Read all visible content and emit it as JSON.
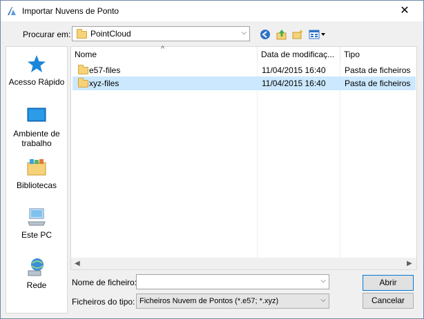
{
  "window": {
    "title": "Importar Nuvens de Ponto",
    "close_glyph": "✕"
  },
  "lookin": {
    "label": "Procurar em:",
    "value": "PointCloud"
  },
  "toolbar": {
    "icons": [
      "back-icon",
      "up-folder-icon",
      "new-folder-icon",
      "view-menu-icon"
    ]
  },
  "places": [
    {
      "label": "Acesso Rápido",
      "icon": "star-icon"
    },
    {
      "label": "Ambiente de trabalho",
      "icon": "desktop-icon"
    },
    {
      "label": "Bibliotecas",
      "icon": "libraries-icon"
    },
    {
      "label": "Este PC",
      "icon": "computer-icon"
    },
    {
      "label": "Rede",
      "icon": "network-icon"
    }
  ],
  "columns": {
    "name": "Nome",
    "date": "Data de modificaç...",
    "type": "Tipo",
    "sort_glyph": "^"
  },
  "rows": [
    {
      "name": "e57-files",
      "date": "11/04/2015 16:40",
      "type": "Pasta de ficheiros",
      "selected": false
    },
    {
      "name": "xyz-files",
      "date": "11/04/2015 16:40",
      "type": "Pasta de ficheiros",
      "selected": true
    }
  ],
  "filename": {
    "label": "Nome de ficheiro:",
    "value": ""
  },
  "filetype": {
    "label": "Ficheiros do tipo:",
    "value": "Ficheiros Nuvem de Pontos (*.e57; *.xyz)"
  },
  "buttons": {
    "open": "Abrir",
    "cancel": "Cancelar"
  },
  "colors": {
    "selection": "#cce8ff",
    "accent": "#0078d7",
    "folder": "#f6d27a"
  }
}
